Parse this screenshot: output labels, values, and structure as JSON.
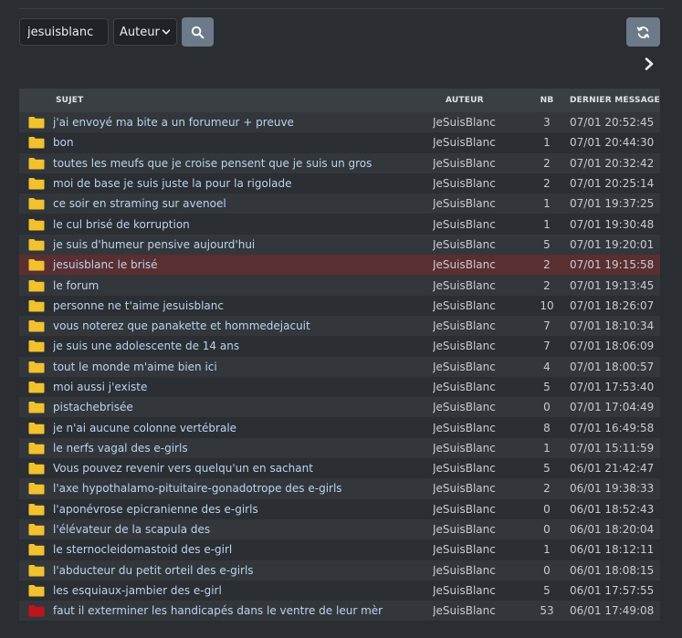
{
  "search": {
    "value": "jesuisblanc",
    "type_selected": "Auteur"
  },
  "icons": {
    "search": "search-icon",
    "refresh": "refresh-icon",
    "next": "chevron-right-icon",
    "folder": "folder-icon"
  },
  "colors": {
    "folder_normal": "#f2c12e",
    "folder_hot": "#c0141b",
    "row_highlight": "#5a2f31",
    "link": "#bcd3f0"
  },
  "table": {
    "headers": {
      "subject": "SUJET",
      "author": "AUTEUR",
      "count": "NB",
      "last": "DERNIER MESSAGE"
    },
    "rows": [
      {
        "subject": "j'ai envoyé ma bite a un forumeur + preuve",
        "author": "JeSuisBlanc",
        "count": "3",
        "last": "07/01 20:52:45",
        "icon": "folder"
      },
      {
        "subject": "bon",
        "author": "JeSuisBlanc",
        "count": "1",
        "last": "07/01 20:44:30",
        "icon": "folder"
      },
      {
        "subject": "toutes les meufs que je croise pensent que je suis un gros",
        "author": "JeSuisBlanc",
        "count": "2",
        "last": "07/01 20:32:42",
        "icon": "folder"
      },
      {
        "subject": "moi de base je suis juste la pour la rigolade",
        "author": "JeSuisBlanc",
        "count": "2",
        "last": "07/01 20:25:14",
        "icon": "folder"
      },
      {
        "subject": "ce soir en straming sur avenoel",
        "author": "JeSuisBlanc",
        "count": "1",
        "last": "07/01 19:37:25",
        "icon": "folder"
      },
      {
        "subject": "le cul brisé de korruption",
        "author": "JeSuisBlanc",
        "count": "1",
        "last": "07/01 19:30:48",
        "icon": "folder"
      },
      {
        "subject": "je suis d'humeur pensive aujourd'hui",
        "author": "JeSuisBlanc",
        "count": "5",
        "last": "07/01 19:20:01",
        "icon": "folder"
      },
      {
        "subject": "jesuisblanc le brisé",
        "author": "JeSuisBlanc",
        "count": "2",
        "last": "07/01 19:15:58",
        "icon": "folder",
        "highlight": true
      },
      {
        "subject": "le forum",
        "author": "JeSuisBlanc",
        "count": "2",
        "last": "07/01 19:13:45",
        "icon": "folder"
      },
      {
        "subject": "personne ne t'aime jesuisblanc",
        "author": "JeSuisBlanc",
        "count": "10",
        "last": "07/01 18:26:07",
        "icon": "folder"
      },
      {
        "subject": "vous noterez que panakette et hommedejacuit",
        "author": "JeSuisBlanc",
        "count": "7",
        "last": "07/01 18:10:34",
        "icon": "folder"
      },
      {
        "subject": "je suis une adolescente de 14 ans",
        "author": "JeSuisBlanc",
        "count": "7",
        "last": "07/01 18:06:09",
        "icon": "folder"
      },
      {
        "subject": "tout le monde m'aime bien ici",
        "author": "JeSuisBlanc",
        "count": "4",
        "last": "07/01 18:00:57",
        "icon": "folder"
      },
      {
        "subject": "moi aussi j'existe",
        "author": "JeSuisBlanc",
        "count": "5",
        "last": "07/01 17:53:40",
        "icon": "folder"
      },
      {
        "subject": "pistachebrisée",
        "author": "JeSuisBlanc",
        "count": "0",
        "last": "07/01 17:04:49",
        "icon": "folder"
      },
      {
        "subject": "je n'ai aucune colonne vertébrale",
        "author": "JeSuisBlanc",
        "count": "8",
        "last": "07/01 16:49:58",
        "icon": "folder"
      },
      {
        "subject": "le nerfs vagal des e-girls",
        "author": "JeSuisBlanc",
        "count": "1",
        "last": "07/01 15:11:59",
        "icon": "folder"
      },
      {
        "subject": "Vous pouvez revenir vers quelqu'un en sachant",
        "author": "JeSuisBlanc",
        "count": "5",
        "last": "06/01 21:42:47",
        "icon": "folder"
      },
      {
        "subject": "l'axe hypothalamo-pituitaire-gonadotrope des e-girls",
        "author": "JeSuisBlanc",
        "count": "2",
        "last": "06/01 19:38:33",
        "icon": "folder"
      },
      {
        "subject": "l'aponévrose epicranienne des e-girls",
        "author": "JeSuisBlanc",
        "count": "0",
        "last": "06/01 18:52:43",
        "icon": "folder"
      },
      {
        "subject": "l'élévateur de la scapula des",
        "author": "JeSuisBlanc",
        "count": "0",
        "last": "06/01 18:20:04",
        "icon": "folder"
      },
      {
        "subject": "le sternocleidomastoid des e-girl",
        "author": "JeSuisBlanc",
        "count": "1",
        "last": "06/01 18:12:11",
        "icon": "folder"
      },
      {
        "subject": "l'abducteur du petit orteil des e-girls",
        "author": "JeSuisBlanc",
        "count": "0",
        "last": "06/01 18:08:15",
        "icon": "folder"
      },
      {
        "subject": "les esquiaux-jambier des e-girl",
        "author": "JeSuisBlanc",
        "count": "5",
        "last": "06/01 17:57:55",
        "icon": "folder"
      },
      {
        "subject": "faut il exterminer les handicapés dans le ventre de leur mèr",
        "author": "JeSuisBlanc",
        "count": "53",
        "last": "06/01 17:49:08",
        "icon": "folder-hot"
      }
    ]
  }
}
